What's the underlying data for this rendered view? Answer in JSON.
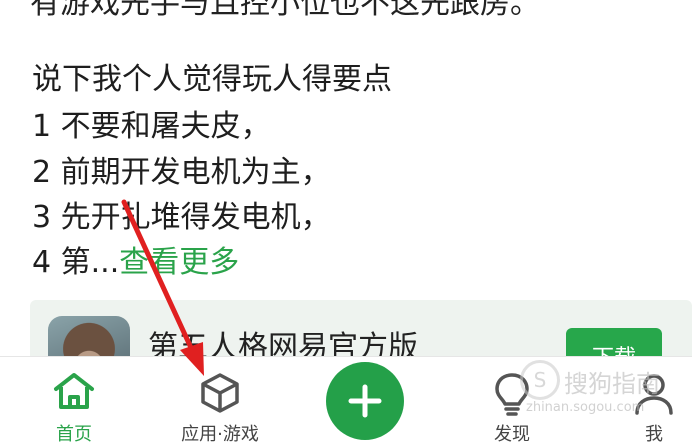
{
  "post": {
    "cut_line": "有游戏先手与且控小位也不这先跟房。",
    "lines": [
      "说下我个人觉得玩人得要点",
      "1 不要和屠夫皮，",
      "2 前期开发电机为主，",
      "3 先开扎堆得发电机，",
      "4 第..."
    ],
    "more_link": "查看更多"
  },
  "app_card": {
    "name": "第五人格网易官方版",
    "download_label": "下载"
  },
  "tabbar": {
    "tabs": [
      {
        "label": "首页",
        "icon": "home-icon",
        "active": true
      },
      {
        "label": "应用·游戏",
        "icon": "box-icon",
        "active": false
      },
      {
        "label": "发现",
        "icon": "lightbulb-icon",
        "active": false
      },
      {
        "label": "我",
        "icon": "user-icon",
        "active": false
      }
    ],
    "fab_icon": "plus-icon"
  },
  "watermark": {
    "text": "搜狗指南",
    "url": "zhinan.sogou.com"
  },
  "colors": {
    "accent": "#2aa34a",
    "fab": "#24a049",
    "annotation_arrow": "#e02020"
  }
}
